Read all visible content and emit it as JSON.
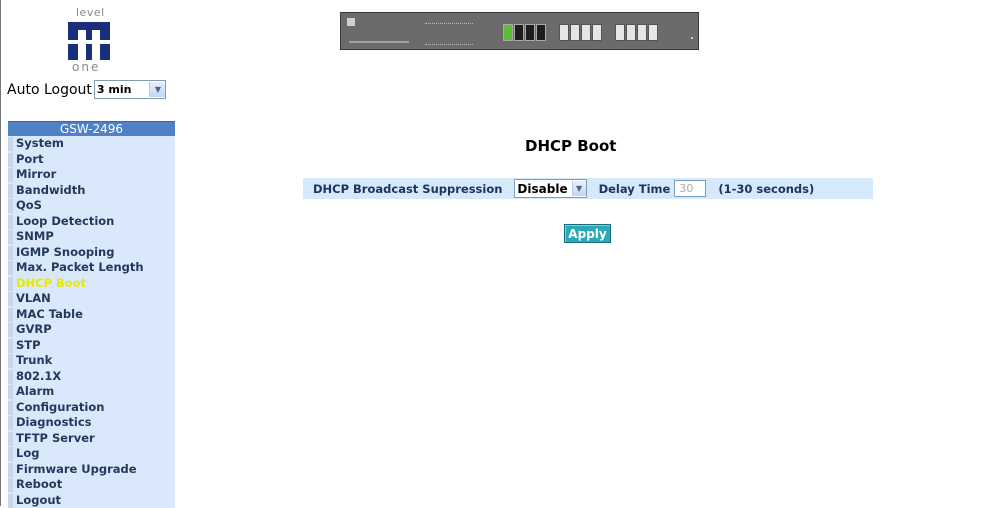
{
  "logo": {
    "text_top": "level",
    "text_bottom": "one"
  },
  "auto_logout": {
    "label": "Auto Logout",
    "selected": "3 min"
  },
  "menu": {
    "header": "GSW-2496",
    "items": [
      {
        "label": "System"
      },
      {
        "label": "Port"
      },
      {
        "label": "Mirror"
      },
      {
        "label": "Bandwidth"
      },
      {
        "label": "QoS"
      },
      {
        "label": "Loop Detection"
      },
      {
        "label": "SNMP"
      },
      {
        "label": "IGMP Snooping"
      },
      {
        "label": "Max. Packet Length"
      },
      {
        "label": "DHCP Boot",
        "active": true
      },
      {
        "label": "VLAN"
      },
      {
        "label": "MAC Table"
      },
      {
        "label": "GVRP"
      },
      {
        "label": "STP"
      },
      {
        "label": "Trunk"
      },
      {
        "label": "802.1X"
      },
      {
        "label": "Alarm"
      },
      {
        "label": "Configuration"
      },
      {
        "label": "Diagnostics"
      },
      {
        "label": "TFTP Server"
      },
      {
        "label": "Log"
      },
      {
        "label": "Firmware Upgrade"
      },
      {
        "label": "Reboot"
      },
      {
        "label": "Logout"
      }
    ]
  },
  "main": {
    "title": "DHCP Boot",
    "suppression_label": "DHCP Broadcast Suppression",
    "suppression_value": "Disable",
    "delay_label": "Delay Time",
    "delay_value": "30",
    "range_hint": "(1-30 seconds)",
    "apply_label": "Apply"
  },
  "colors": {
    "menu_bg": "#d9e9fb",
    "menu_header": "#4f81c7",
    "active_item": "#e8e800",
    "apply_button": "#2aa9b8",
    "settings_row": "#d6e9fb"
  },
  "icons": {
    "dropdown": "chevron-down-icon",
    "device": "switch-device-image",
    "logo": "levelone-logo"
  }
}
